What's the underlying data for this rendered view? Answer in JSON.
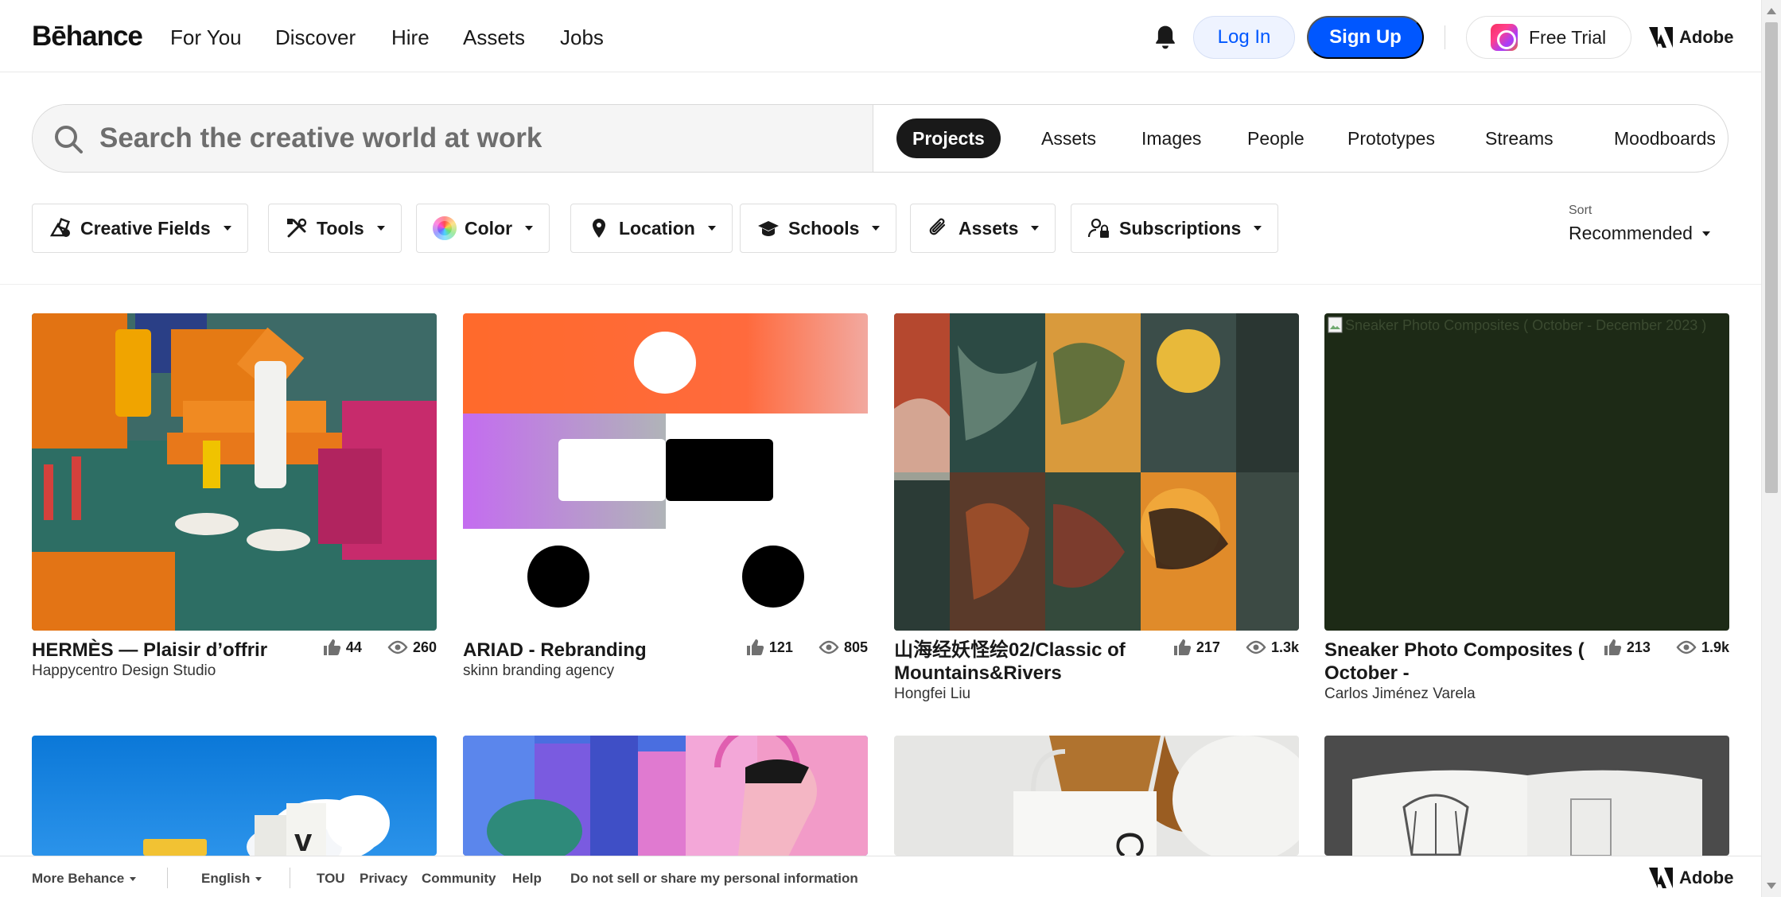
{
  "brand": {
    "logo": "Bēhance"
  },
  "nav": {
    "links": [
      "For You",
      "Discover",
      "Hire",
      "Assets",
      "Jobs"
    ],
    "login_label": "Log In",
    "signup_label": "Sign Up",
    "trial_label": "Free Trial",
    "adobe_label": "Adobe"
  },
  "search": {
    "placeholder": "Search the creative world at work",
    "tabs": [
      "Projects",
      "Assets",
      "Images",
      "People",
      "Prototypes",
      "Streams",
      "Moodboards"
    ],
    "active_tab": "Projects"
  },
  "filters": {
    "items": [
      "Creative Fields",
      "Tools",
      "Color",
      "Location",
      "Schools",
      "Assets",
      "Subscriptions"
    ],
    "sort_label": "Sort",
    "sort_value": "Recommended"
  },
  "projects": [
    {
      "title": "HERMÈS — Plaisir d’offrir",
      "owner": "Happycentro Design Studio",
      "likes": "44",
      "views": "260"
    },
    {
      "title": "ARIAD - Rebranding",
      "owner": "skinn branding agency",
      "likes": "121",
      "views": "805"
    },
    {
      "title": "山海经妖怪绘02/Classic of Mountains&Rivers",
      "owner": "Hongfei Liu",
      "likes": "217",
      "views": "1.3k"
    },
    {
      "title": "Sneaker Photo Composites ( October -",
      "owner": "Carlos Jiménez Varela",
      "likes": "213",
      "views": "1.9k",
      "broken_image_alt": "Sneaker Photo Composites ( October - December 2023 )"
    }
  ],
  "footer": {
    "more": "More Behance",
    "language": "English",
    "links": [
      "TOU",
      "Privacy",
      "Community",
      "Help",
      "Do not sell or share my personal information"
    ],
    "adobe_label": "Adobe"
  },
  "colors": {
    "accent": "#0057ff",
    "text": "#191919",
    "active_tab_bg": "#191919"
  }
}
